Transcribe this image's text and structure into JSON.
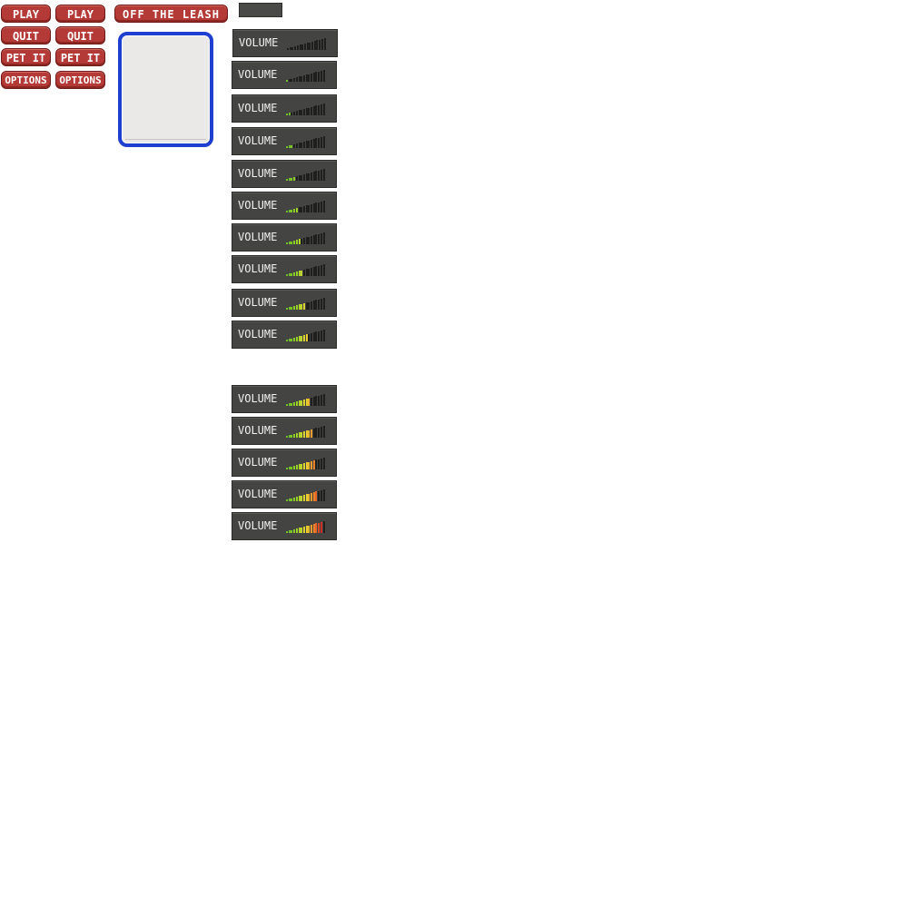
{
  "buttons": {
    "play": "PLAY",
    "quit": "QUIT",
    "pet_it": "PET IT",
    "options": "OPTIONS",
    "off_the_leash": "OFF THE LEASH"
  },
  "volume": {
    "label": "VOLUME",
    "segment_count": 16,
    "levels": [
      0,
      1,
      2,
      3,
      4,
      5,
      6,
      7,
      8,
      9,
      10,
      11,
      12,
      13,
      15
    ],
    "segment_colors": [
      "#6fbf2a",
      "#6fbf2a",
      "#7cc628",
      "#8acb27",
      "#9bd026",
      "#aed12a",
      "#c3d32d",
      "#d9d42f",
      "#e5cb2f",
      "#e9b52f",
      "#ea9c2c",
      "#e9802a",
      "#e56627",
      "#d94a25",
      "#c93223",
      "#b52421"
    ],
    "off_color": "#1f1f1e"
  },
  "colors": {
    "button_red": "#b33a36",
    "frame_blue": "#1e3fcf",
    "panel_dark": "#444443"
  }
}
